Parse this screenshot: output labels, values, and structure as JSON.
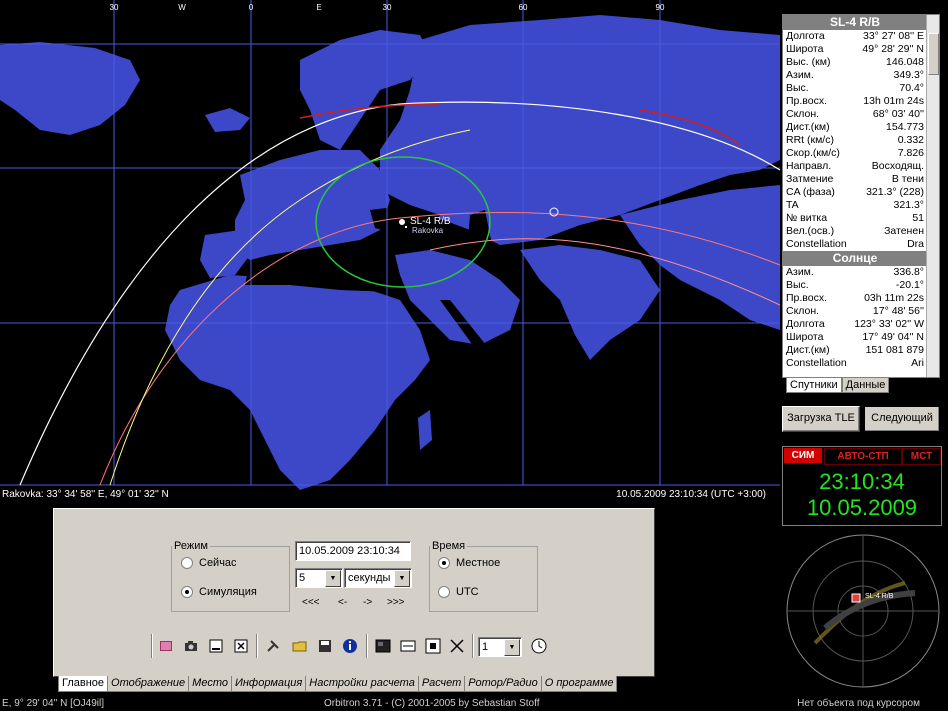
{
  "map": {
    "lon_labels": [
      "30",
      "W",
      "0",
      "E",
      "30",
      "60",
      "90"
    ],
    "satellite_label": "SL-4 R/B",
    "observer_label": "Rakovka",
    "status_left": "Rakovka: 33° 34' 58'' E, 49° 01' 32'' N",
    "status_right": "10.05.2009 23:10:34 (UTC +3:00)"
  },
  "info": {
    "sat_title": "SL-4 R/B",
    "sat_rows": [
      {
        "k": "Долгота",
        "v": "33° 27' 08'' E"
      },
      {
        "k": "Широта",
        "v": "49° 28' 29'' N"
      },
      {
        "k": "Выс. (км)",
        "v": "146.048"
      },
      {
        "k": "Азим.",
        "v": "349.3°"
      },
      {
        "k": "Выс.",
        "v": "70.4°"
      },
      {
        "k": "Пр.восх.",
        "v": "13h 01m 24s"
      },
      {
        "k": "Склон.",
        "v": "68° 03' 40''"
      },
      {
        "k": "Дист.(км)",
        "v": "154.773"
      },
      {
        "k": "RRt (км/с)",
        "v": "0.332"
      },
      {
        "k": "Скор.(км/с)",
        "v": "7.826"
      },
      {
        "k": "Направл.",
        "v": "Восходящ."
      },
      {
        "k": "Затмение",
        "v": "В тени"
      },
      {
        "k": "CA (фаза)",
        "v": "321.3° (228)"
      },
      {
        "k": "TA",
        "v": "321.3°"
      },
      {
        "k": "№ витка",
        "v": "51"
      },
      {
        "k": "Вел.(осв.)",
        "v": "Затенен"
      },
      {
        "k": "Constellation",
        "v": "Dra"
      }
    ],
    "sun_title": "Солнце",
    "sun_rows": [
      {
        "k": "Азим.",
        "v": "336.8°"
      },
      {
        "k": "Выс.",
        "v": "-20.1°"
      },
      {
        "k": "Пр.восх.",
        "v": "03h 11m 22s"
      },
      {
        "k": "Склон.",
        "v": "17° 48' 56''"
      },
      {
        "k": "Долгота",
        "v": "123° 33' 02'' W"
      },
      {
        "k": "Широта",
        "v": "17° 49' 04'' N"
      },
      {
        "k": "Дист.(км)",
        "v": "151 081 879"
      },
      {
        "k": "Constellation",
        "v": "Ari"
      }
    ],
    "tabs": [
      "Спутники",
      "Данные"
    ]
  },
  "buttons": {
    "load_tle": "Загрузка TLE",
    "next": "Следующий"
  },
  "clock": {
    "modes": [
      "СИМ",
      "АВТО-СТП",
      "МСТ"
    ],
    "time": "23:10:34",
    "date": "10.05.2009"
  },
  "radar": {
    "sat_label": "SL-4 R/B"
  },
  "control": {
    "mode_legend": "Режим",
    "mode_now": "Сейчас",
    "mode_sim": "Симуляция",
    "datetime_value": "10.05.2009 23:10:34",
    "step_value": "5",
    "unit_value": "секунды",
    "nav": [
      "<<<",
      "<-",
      "->",
      ">>>"
    ],
    "time_legend": "Время",
    "time_local": "Местное",
    "time_utc": "UTC",
    "zoom_value": "1"
  },
  "tabs": [
    "Главное",
    "Отображение",
    "Место",
    "Информация",
    "Настройки расчета",
    "Расчет",
    "Ротор/Радио",
    "О программе"
  ],
  "statusbar": {
    "left": "E, 9° 29' 04'' N [OJ49il]",
    "center": "Orbitron 3.71 - (C) 2001-2005 by Sebastian Stoff",
    "right": "Нет объекта под курсором"
  },
  "colors": {
    "land": "#3c48c8",
    "water": "#000000",
    "grid": "#4a5be0",
    "footprint": "#28c83c",
    "clock_text": "#21e51d",
    "mode_active": "#d00000"
  }
}
